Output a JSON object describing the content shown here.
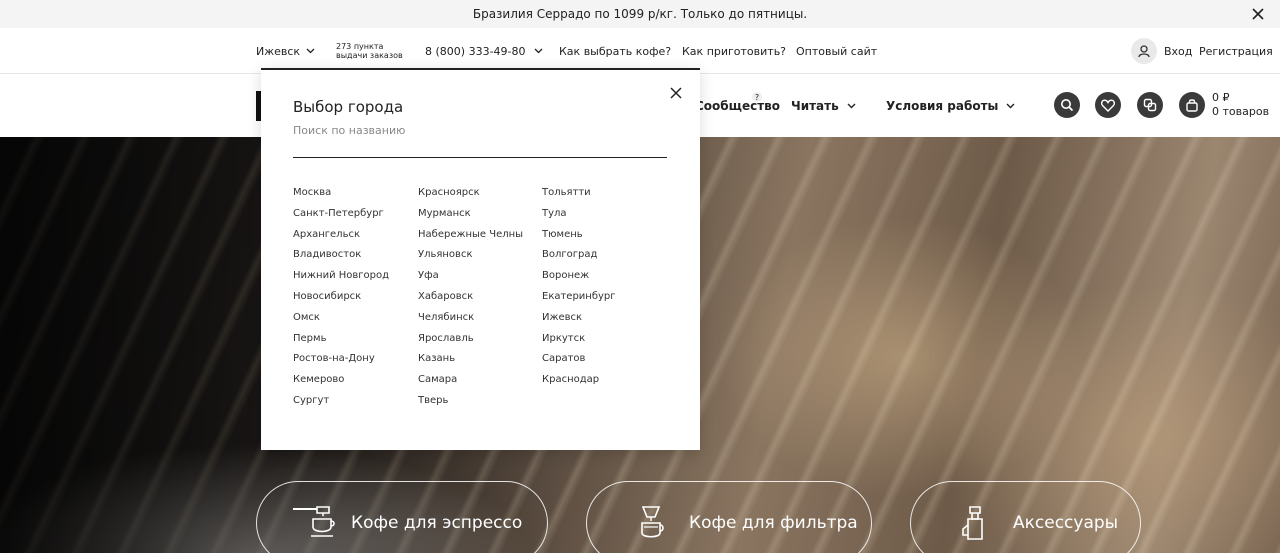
{
  "promo": {
    "text": "Бразилия Серрадо по 1099 р/кг. Только до пятницы."
  },
  "topnav": {
    "city": "Ижевск",
    "points_line1": "273 пункта",
    "points_line2": "выдачи заказов",
    "phone": "8 (800) 333-49-80",
    "how_choose": "Как выбрать кофе?",
    "how_brew": "Как приготовить?",
    "wholesale": "Оптовый сайт",
    "login": "Вход",
    "register": "Регистрация"
  },
  "header": {
    "community": "Сообщество",
    "question_mark": "?",
    "read": "Читать",
    "terms": "Условия работы",
    "cart_sum": "0 ₽",
    "cart_count": "0 товаров"
  },
  "city_popup": {
    "title": "Выбор города",
    "search_placeholder": "Поиск по названию",
    "columns": [
      [
        "Москва",
        "Санкт-Петербург",
        "Архангельск",
        "Владивосток",
        "Нижний Новгород",
        "Новосибирск",
        "Омск",
        "Пермь",
        "Ростов-на-Дону",
        "Кемерово",
        "Сургут"
      ],
      [
        "Красноярск",
        "Мурманск",
        "Набережные Челны",
        "Ульяновск",
        "Уфа",
        "Хабаровск",
        "Челябинск",
        "Ярославль",
        "Казань",
        "Самара",
        "Тверь"
      ],
      [
        "Тольятти",
        "Тула",
        "Тюмень",
        "Волгоград",
        "Воронеж",
        "Екатеринбург",
        "Ижевск",
        "Иркутск",
        "Саратов",
        "Краснодар"
      ]
    ]
  },
  "categories": {
    "espresso": "Кофе для эспрессо",
    "filter": "Кофе для фильтра",
    "accessories": "Аксессуары"
  },
  "icons": [
    "close-icon",
    "chevron-down-icon",
    "user-icon",
    "search-icon",
    "heart-icon",
    "compare-icon",
    "bag-icon",
    "espresso-machine-icon",
    "filter-dripper-icon",
    "grinder-icon"
  ]
}
